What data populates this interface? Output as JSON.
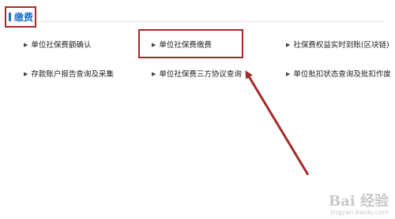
{
  "section": {
    "title": "缴费"
  },
  "menu": {
    "row1": [
      {
        "label": "单位社保费额确认"
      },
      {
        "label": "单位社保费缴费"
      },
      {
        "label": "社保费权益实时到账(区块链)"
      }
    ],
    "row2": [
      {
        "label": "存款账户报告查询及采集"
      },
      {
        "label": "单位社保费三方协议查询"
      },
      {
        "label": "单位批扣状态查询及批扣作废"
      }
    ]
  },
  "bullet_icon": "triangle-right-icon",
  "annotation": {
    "color": "#a52a2a"
  },
  "watermark": {
    "logo": "Bai 经验",
    "url": "jingyan.baidu.com"
  }
}
